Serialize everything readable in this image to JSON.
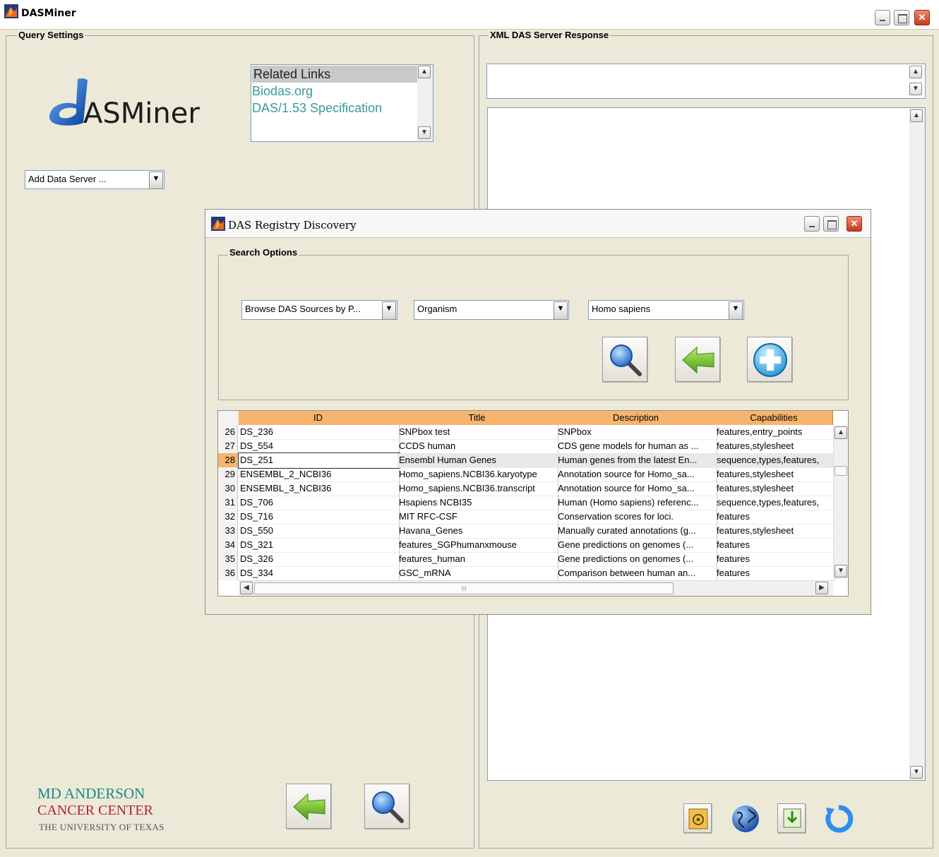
{
  "window": {
    "title": "DASMiner",
    "min_label": "_",
    "max_label": "□",
    "close_label": "✕"
  },
  "query_settings": {
    "label": "Query Settings",
    "logo_text": "ASMiner",
    "related_links": {
      "header": "Related Links",
      "items": [
        "Biodas.org",
        "DAS/1.53 Specification"
      ]
    },
    "add_server": "Add Data Server ..."
  },
  "xml_panel": {
    "label": "XML DAS Server Response"
  },
  "footer": {
    "org_line1": "MD ANDERSON",
    "org_line2": "CANCER CENTER",
    "org_line3": "THE UNIVERSITY OF TEXAS"
  },
  "dialog": {
    "title": "DAS Registry Discovery",
    "search_options_label": "Search Options",
    "browse_select": "Browse DAS Sources by P...",
    "category_select": "Organism",
    "value_select": "Homo sapiens",
    "table": {
      "columns": [
        "ID",
        "Title",
        "Description",
        "Capabilities"
      ],
      "rows": [
        {
          "n": "26",
          "id": "DS_236",
          "title": "SNPbox test",
          "desc": "SNPbox",
          "cap": "features,entry_points"
        },
        {
          "n": "27",
          "id": "DS_554",
          "title": "CCDS human",
          "desc": "CDS gene models for human as ...",
          "cap": "features,stylesheet"
        },
        {
          "n": "28",
          "id": "DS_251",
          "title": "Ensembl Human Genes",
          "desc": "Human genes from the latest En...",
          "cap": "sequence,types,features,"
        },
        {
          "n": "29",
          "id": "ENSEMBL_2_NCBI36",
          "title": "Homo_sapiens.NCBI36.karyotype",
          "desc": "Annotation source for Homo_sa...",
          "cap": "features,stylesheet"
        },
        {
          "n": "30",
          "id": "ENSEMBL_3_NCBI36",
          "title": "Homo_sapiens.NCBI36.transcript",
          "desc": "Annotation source for Homo_sa...",
          "cap": "features,stylesheet"
        },
        {
          "n": "31",
          "id": "DS_706",
          "title": "Hsapiens NCBI35",
          "desc": "Human (Homo sapiens) referenc...",
          "cap": "sequence,types,features,"
        },
        {
          "n": "32",
          "id": "DS_716",
          "title": "MIT RFC-CSF",
          "desc": "Conservation scores for loci.",
          "cap": "features"
        },
        {
          "n": "33",
          "id": "DS_550",
          "title": "Havana_Genes",
          "desc": "Manually curated annotations (g...",
          "cap": "features,stylesheet"
        },
        {
          "n": "34",
          "id": "DS_321",
          "title": "features_SGPhumanxmouse",
          "desc": "Gene predictions on genomes  (...",
          "cap": "features"
        },
        {
          "n": "35",
          "id": "DS_326",
          "title": "features_human",
          "desc": "Gene predictions on genomes  (...",
          "cap": "features"
        },
        {
          "n": "36",
          "id": "DS_334",
          "title": "GSC_mRNA",
          "desc": "Comparison between human an...",
          "cap": "features"
        }
      ],
      "hscroll_grip": "III"
    }
  },
  "colors": {
    "background": "#ece9d8",
    "header_orange": "#f6b56e",
    "link_teal": "#3a9a95",
    "accent_green": "#5fb62a",
    "accent_blue": "#1f78d1"
  }
}
